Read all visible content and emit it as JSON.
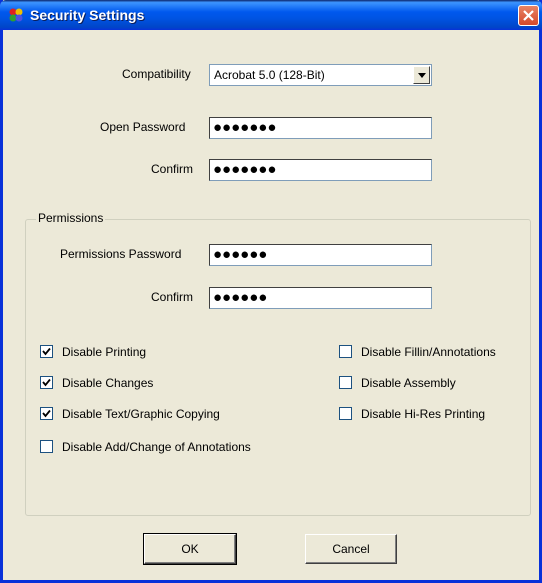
{
  "window": {
    "title": "Security Settings"
  },
  "compatibility": {
    "label": "Compatibility",
    "value": "Acrobat 5.0 (128-Bit)"
  },
  "open_password": {
    "label": "Open Password",
    "value": "●●●●●●●"
  },
  "confirm_open": {
    "label": "Confirm",
    "value": "●●●●●●●"
  },
  "permissions": {
    "legend": "Permissions",
    "password": {
      "label": "Permissions Password",
      "value": "●●●●●●"
    },
    "confirm": {
      "label": "Confirm",
      "value": "●●●●●●"
    },
    "checkboxes": [
      {
        "label": "Disable Printing",
        "checked": true
      },
      {
        "label": "Disable Changes",
        "checked": true
      },
      {
        "label": "Disable Text/Graphic Copying",
        "checked": true
      },
      {
        "label": "Disable Add/Change of Annotations",
        "checked": false
      },
      {
        "label": "Disable Fillin/Annotations",
        "checked": false
      },
      {
        "label": "Disable Assembly",
        "checked": false
      },
      {
        "label": "Disable Hi-Res Printing",
        "checked": false
      }
    ]
  },
  "buttons": {
    "ok": "OK",
    "cancel": "Cancel"
  },
  "colors": {
    "titlebar": "#0054E3",
    "face": "#ECE9D8",
    "close": "#D5482A"
  },
  "icons": {
    "app": "security-app-icon",
    "close": "close-icon",
    "dropdown": "chevron-down-icon"
  }
}
